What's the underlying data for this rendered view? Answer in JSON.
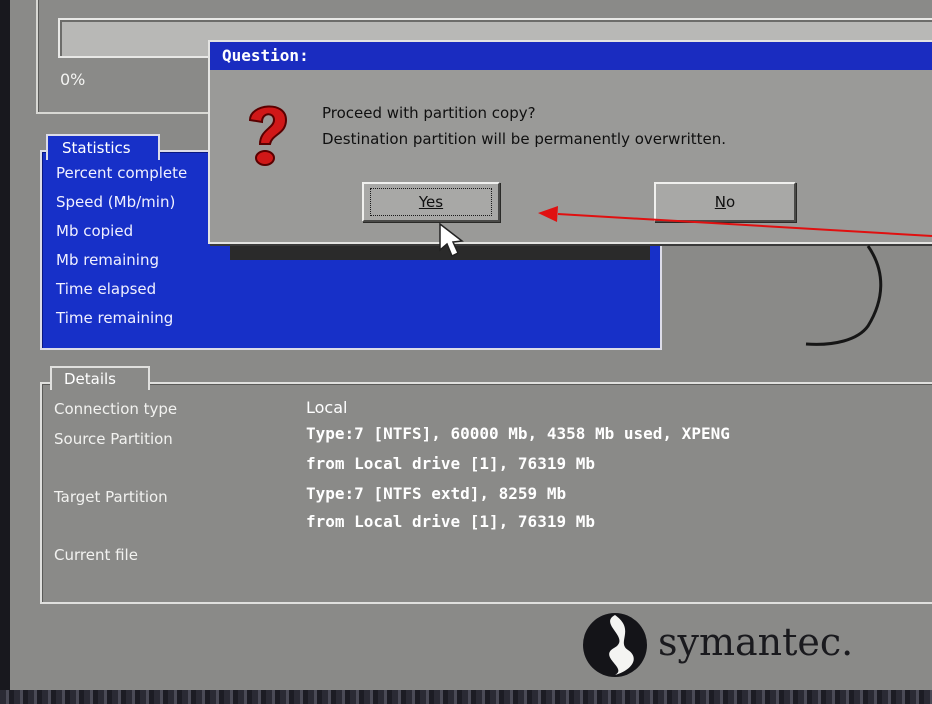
{
  "progress": {
    "percent_text": "0%",
    "percent": 0
  },
  "statistics": {
    "tab_label": "Statistics",
    "labels": [
      "Percent complete",
      "Speed (Mb/min)",
      "Mb copied",
      "Mb remaining",
      "Time elapsed",
      "Time remaining"
    ]
  },
  "details": {
    "tab_label": "Details",
    "connection_type_label": "Connection type",
    "connection_type_value": "Local",
    "source_label": "Source Partition",
    "source_line1": "Type:7 [NTFS], 60000 Mb, 4358 Mb used, XPENG",
    "source_line2": "from Local drive [1], 76319 Mb",
    "target_label": "Target Partition",
    "target_line1": "Type:7 [NTFS extd], 8259 Mb",
    "target_line2": "from Local drive [1], 76319 Mb",
    "current_file_label": "Current file"
  },
  "dialog": {
    "title": "Question:",
    "line1": "Proceed with partition copy?",
    "line2": "Destination partition will be permanently overwritten.",
    "yes_label": "Yes",
    "no_label_u": "N",
    "no_label_rest": "o"
  },
  "brand": {
    "logo_text": "symantec."
  },
  "colors": {
    "screen_bg": "#8a8a88",
    "stats_blue": "#1730c8",
    "title_blue": "#1a2cc0",
    "arrow_red": "#e01010"
  },
  "icons": [
    "question-mark-icon",
    "mouse-pointer-icon",
    "symantec-logo-icon",
    "red-arrow-annotation"
  ]
}
